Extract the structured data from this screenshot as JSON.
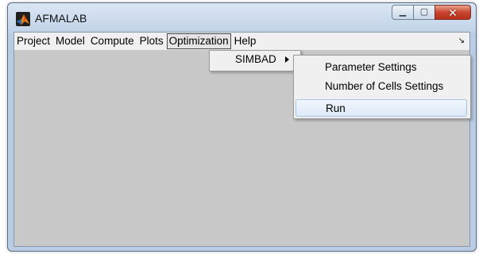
{
  "window": {
    "title": "AFMALAB",
    "icon": "matlab-logo-icon"
  },
  "window_controls": {
    "minimize": "▁",
    "maximize": "▢",
    "close": "✕"
  },
  "menubar": {
    "items": [
      {
        "label": "Project"
      },
      {
        "label": "Model"
      },
      {
        "label": "Compute"
      },
      {
        "label": "Plots"
      },
      {
        "label": "Optimization",
        "open": true
      },
      {
        "label": "Help"
      }
    ],
    "overflow_arrow": "↘"
  },
  "submenu_optimization": {
    "items": [
      {
        "label": "SIMBAD",
        "has_submenu": true
      }
    ]
  },
  "submenu_simbad": {
    "items": [
      {
        "label": "Parameter Settings"
      },
      {
        "label": "Number of Cells Settings"
      },
      {
        "label": "Run",
        "highlighted": true
      }
    ]
  }
}
